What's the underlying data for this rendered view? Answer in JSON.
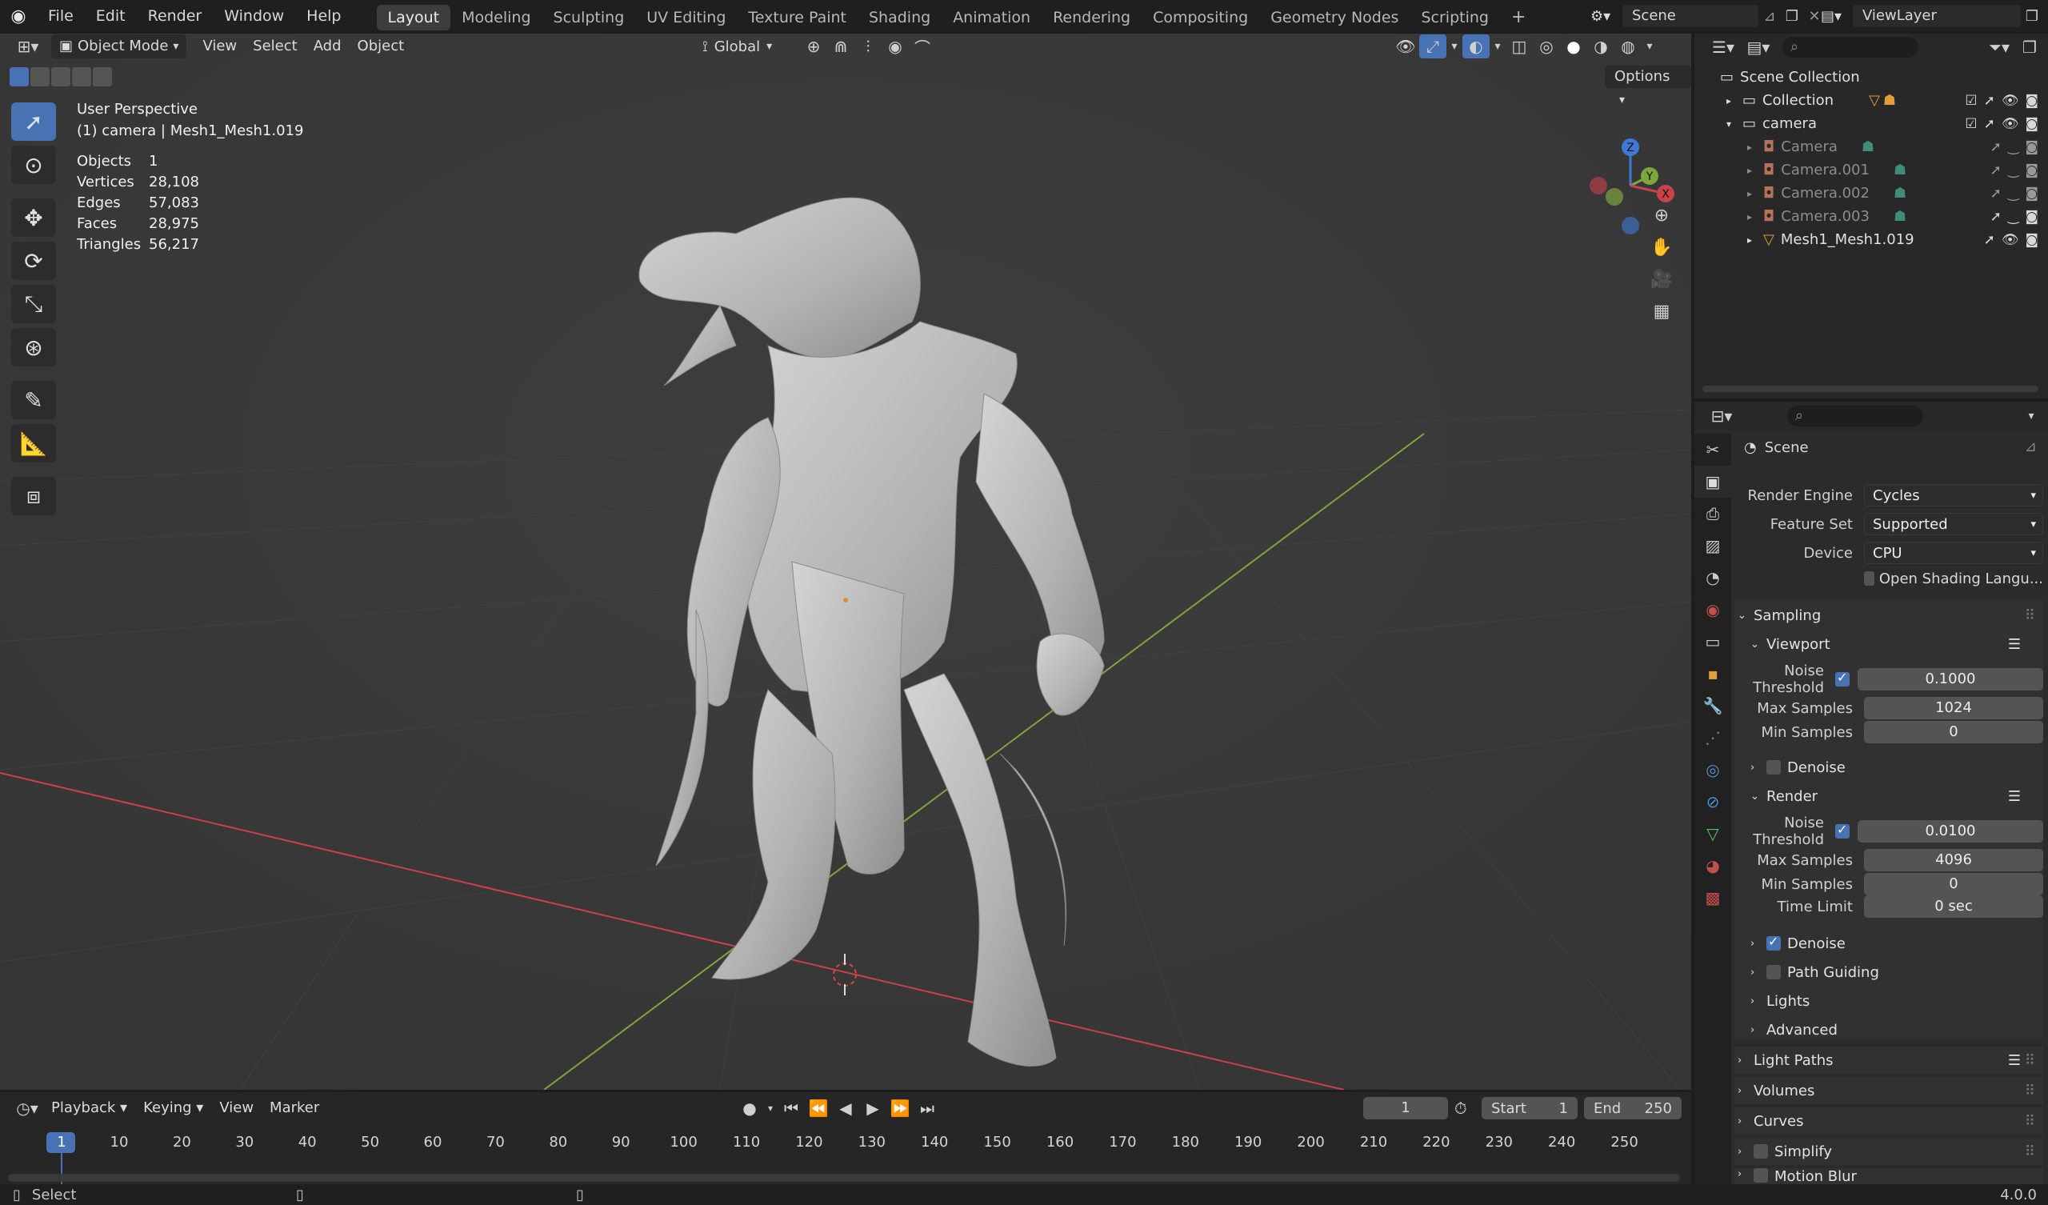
{
  "menu": [
    "File",
    "Edit",
    "Render",
    "Window",
    "Help"
  ],
  "workspaces": [
    "Layout",
    "Modeling",
    "Sculpting",
    "UV Editing",
    "Texture Paint",
    "Shading",
    "Animation",
    "Rendering",
    "Compositing",
    "Geometry Nodes",
    "Scripting"
  ],
  "scene_name": "Scene",
  "view_layer": "ViewLayer",
  "viewport": {
    "mode": "Object Mode",
    "menus": [
      "View",
      "Select",
      "Add",
      "Object"
    ],
    "transform_orientation": "Global",
    "options_label": "Options",
    "perspective": "User Perspective",
    "active_object": "(1) camera | Mesh1_Mesh1.019",
    "stats": [
      {
        "label": "Objects",
        "value": "1"
      },
      {
        "label": "Vertices",
        "value": "28,108"
      },
      {
        "label": "Edges",
        "value": "57,083"
      },
      {
        "label": "Faces",
        "value": "28,975"
      },
      {
        "label": "Triangles",
        "value": "56,217"
      }
    ],
    "gizmo": {
      "z": "Z",
      "y": "Y",
      "x": "X"
    }
  },
  "timeline": {
    "menus": [
      "Playback",
      "Keying",
      "View",
      "Marker"
    ],
    "current_frame": "1",
    "start_label": "Start",
    "start": "1",
    "end_label": "End",
    "end": "250",
    "ticks": [
      "1",
      "10",
      "20",
      "30",
      "40",
      "50",
      "60",
      "70",
      "80",
      "90",
      "100",
      "110",
      "120",
      "130",
      "140",
      "150",
      "160",
      "170",
      "180",
      "190",
      "200",
      "210",
      "220",
      "230",
      "240",
      "250"
    ]
  },
  "status": {
    "select": "Select",
    "version": "4.0.0"
  },
  "outliner": {
    "root": "Scene Collection",
    "items": [
      {
        "name": "Collection",
        "indent": 1,
        "dim": false
      },
      {
        "name": "camera",
        "indent": 1,
        "dim": false
      },
      {
        "name": "Camera",
        "indent": 2,
        "dim": true
      },
      {
        "name": "Camera.001",
        "indent": 2,
        "dim": true
      },
      {
        "name": "Camera.002",
        "indent": 2,
        "dim": true
      },
      {
        "name": "Camera.003",
        "indent": 2,
        "dim": true
      },
      {
        "name": "Mesh1_Mesh1.019",
        "indent": 2,
        "dim": false
      }
    ]
  },
  "properties": {
    "context": "Scene",
    "render_engine_label": "Render Engine",
    "render_engine": "Cycles",
    "feature_set_label": "Feature Set",
    "feature_set": "Supported",
    "device_label": "Device",
    "device": "CPU",
    "osl_label": "Open Shading Langu...",
    "sampling": "Sampling",
    "viewport": "Viewport",
    "render": "Render",
    "noise_threshold_label": "Noise Threshold",
    "viewport_noise": "0.1000",
    "max_samples_label": "Max Samples",
    "viewport_max": "1024",
    "min_samples_label": "Min Samples",
    "viewport_min": "0",
    "denoise": "Denoise",
    "render_noise": "0.0100",
    "render_max": "4096",
    "render_min": "0",
    "time_limit_label": "Time Limit",
    "time_limit": "0 sec",
    "path_guiding": "Path Guiding",
    "lights": "Lights",
    "advanced": "Advanced",
    "light_paths": "Light Paths",
    "volumes": "Volumes",
    "curves": "Curves",
    "simplify": "Simplify",
    "motion_blur": "Motion Blur"
  },
  "colors": {
    "accent": "#4772b3",
    "x_axis": "#c8414b",
    "y_axis": "#7fa53c",
    "z_axis": "#3f79d6"
  }
}
